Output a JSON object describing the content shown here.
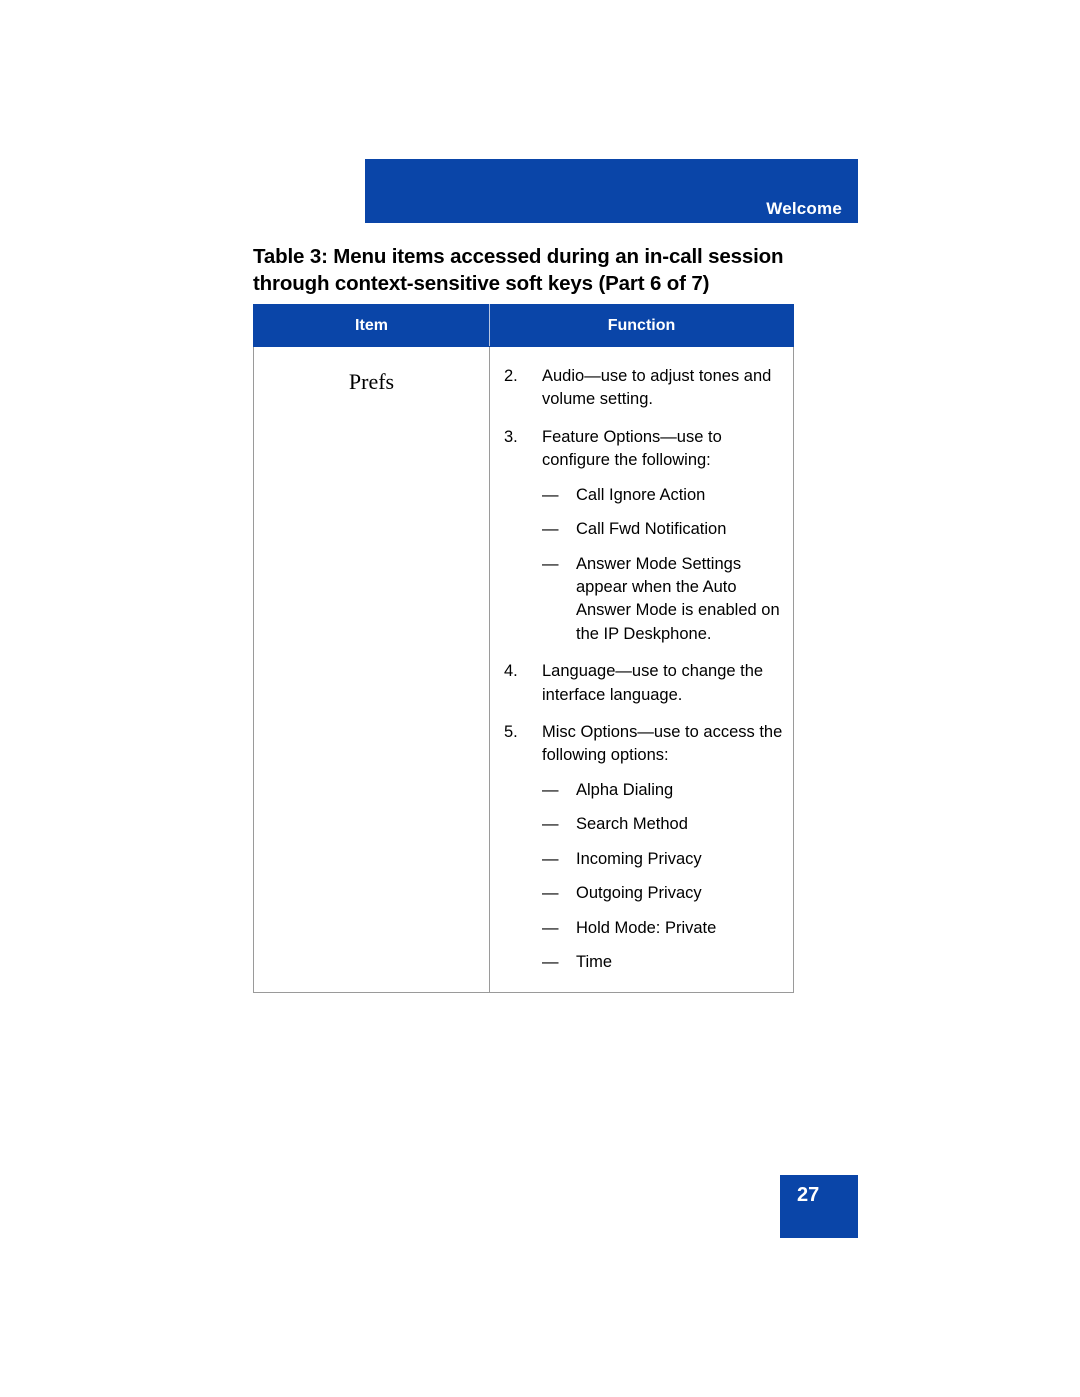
{
  "header": {
    "section_title": "Welcome",
    "bar_color": "#0a45a8"
  },
  "table_caption": "Table 3: Menu items accessed during an in-call session through context-sensitive soft keys (Part 6 of 7)",
  "table": {
    "columns": [
      "Item",
      "Function"
    ],
    "row": {
      "item": "Prefs",
      "entries": [
        {
          "number": "2.",
          "text": "Audio—use to adjust tones and volume setting.",
          "subitems": []
        },
        {
          "number": "3.",
          "text": "Feature Options—use to configure the following:",
          "subitems": [
            "Call Ignore Action",
            "Call Fwd Notification",
            "Answer Mode Settings appear when the Auto Answer Mode is enabled on the IP Deskphone."
          ]
        },
        {
          "number": "4.",
          "text": "Language—use to change the interface language.",
          "subitems": []
        },
        {
          "number": "5.",
          "text": "Misc Options—use to access the following options:",
          "subitems": [
            "Alpha Dialing",
            "Search Method",
            "Incoming Privacy",
            "Outgoing Privacy",
            "Hold Mode: Private",
            "Time"
          ]
        }
      ]
    }
  },
  "footer": {
    "page_number": "27"
  },
  "glyphs": {
    "em_dash": "—"
  }
}
